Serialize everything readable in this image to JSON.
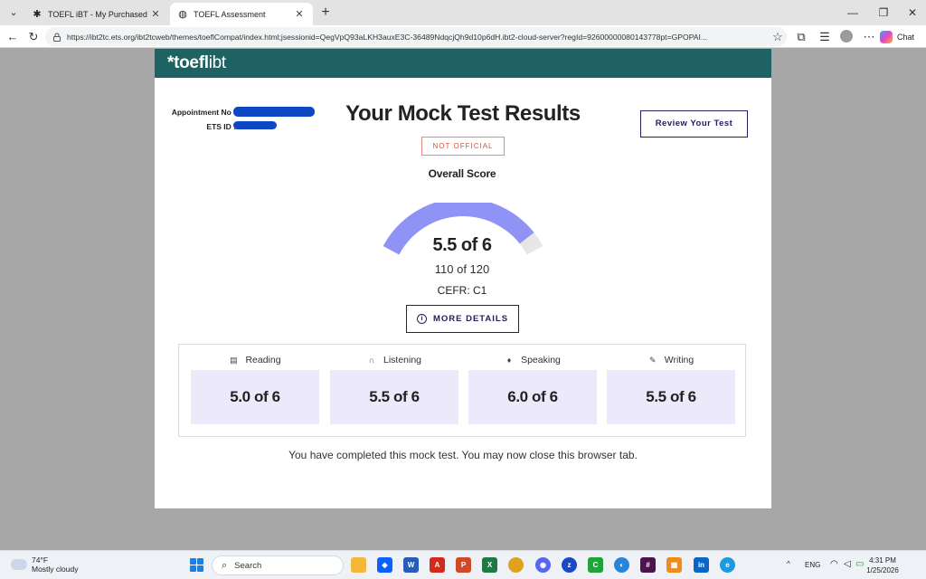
{
  "browser": {
    "tabs": [
      {
        "label": "TOEFL iBT - My Purchased Test Pre",
        "icon": "ets-star-icon"
      },
      {
        "label": "TOEFL Assessment",
        "icon": "globe-icon"
      }
    ],
    "url": "https://ibt2tc.ets.org/ibt2tcweb/themes/toeflCompat/index.html;jsessionid=QegVpQ93aLKH3auxE3C-36489NdqcjQh9d10p6dH.ibt2-cloud-server?regId=92600000080143778pt=GPOPAI...",
    "chat_label": "Chat"
  },
  "page": {
    "brand": {
      "prefix": "*toefl",
      "suffix": "ibt"
    },
    "appointment_label": "Appointment No :",
    "ets_id_label": "ETS ID :",
    "title": "Your Mock Test Results",
    "badge": "NOT OFFICIAL",
    "review_button": "Review Your Test",
    "overall_label": "Overall Score",
    "overall_score": "5.5 of 6",
    "overall_fraction": 0.917,
    "scaled_score": "110 of 120",
    "cefr": "CEFR: C1",
    "more_details": "MORE DETAILS",
    "sections": [
      {
        "name": "Reading",
        "score": "5.0 of 6",
        "icon": "book-icon"
      },
      {
        "name": "Listening",
        "score": "5.5 of 6",
        "icon": "headphones-icon"
      },
      {
        "name": "Speaking",
        "score": "6.0 of 6",
        "icon": "microphone-icon"
      },
      {
        "name": "Writing",
        "score": "5.5 of 6",
        "icon": "pencil-icon"
      }
    ],
    "complete_message": "You have completed this mock test. You may now close this browser tab.",
    "colors": {
      "brand": "#1e6263",
      "gauge": "#8f93f5",
      "gauge_track": "#e6e6e6",
      "section_bg": "#eceafa",
      "button": "#22205c",
      "badge": "#d9503c"
    }
  },
  "taskbar": {
    "temperature": "74°F",
    "condition": "Mostly cloudy",
    "search_placeholder": "Search",
    "language": "ENG",
    "time": "4:31 PM",
    "date": "1/25/2026"
  }
}
